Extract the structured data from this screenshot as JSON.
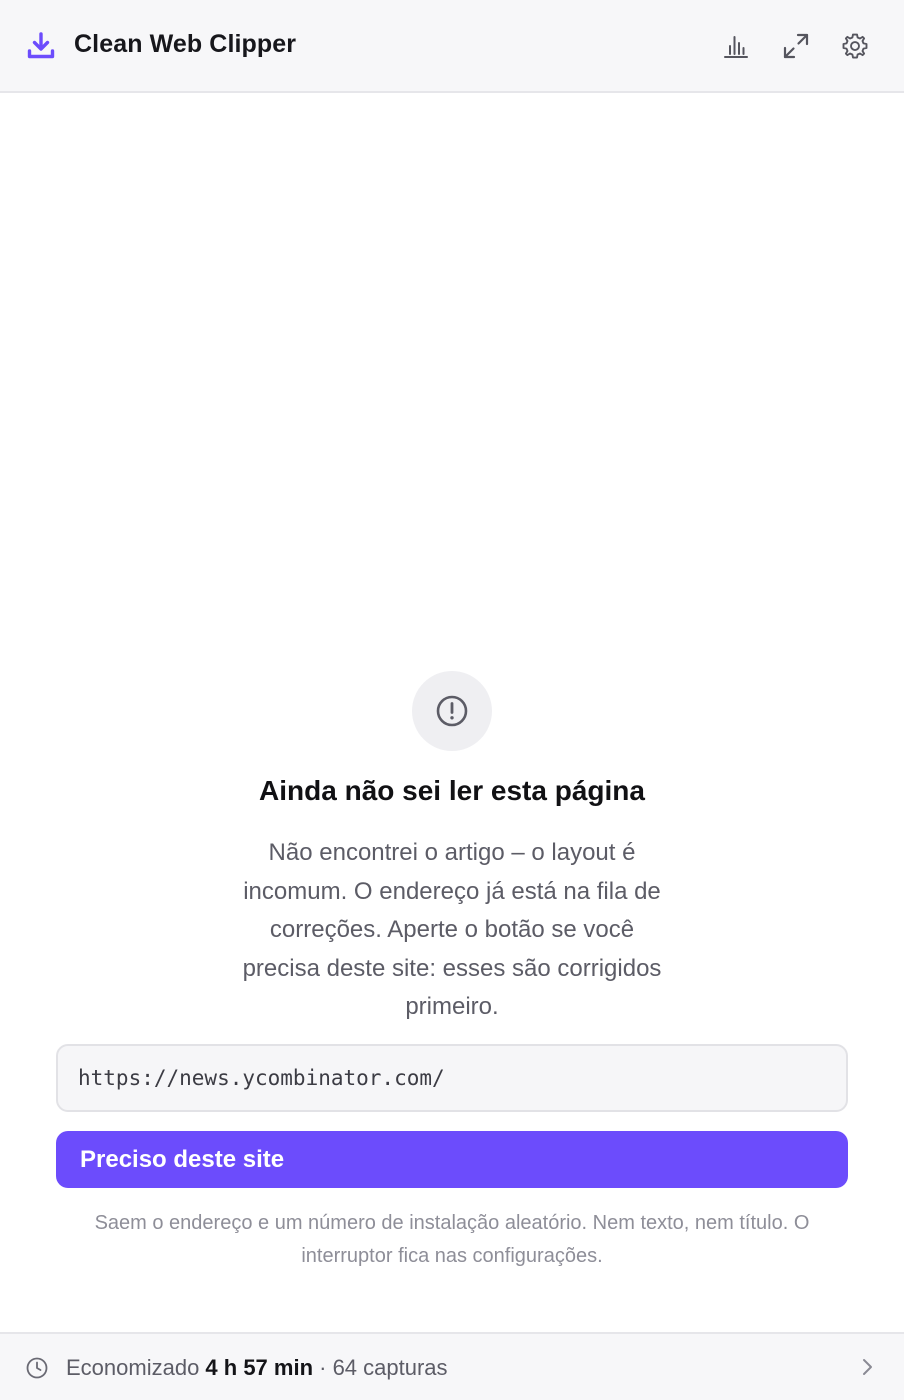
{
  "header": {
    "title": "Clean Web Clipper",
    "brand_icon": "download-icon",
    "actions": [
      {
        "name": "stats",
        "icon": "bar-chart-icon"
      },
      {
        "name": "expand",
        "icon": "expand-icon"
      },
      {
        "name": "settings",
        "icon": "gear-icon"
      }
    ]
  },
  "state": {
    "icon": "alert-circle-icon",
    "title": "Ainda não sei ler esta página",
    "description": "Não encontrei o artigo – o layout é incomum. O endereço já está na fila de correções. Aperte o botão se você precisa deste site: esses são corrigidos primeiro."
  },
  "url": "https://news.ycombinator.com/",
  "primary_button": "Preciso deste site",
  "privacy_note": "Saem o endereço e um número de instalação aleatório. Nem texto, nem título. O interruptor fica nas configurações.",
  "footer": {
    "prefix": "Economizado ",
    "time_saved": "4 h 57 min",
    "suffix": " · 64 capturas",
    "icon": "clock-icon",
    "chevron": "chevron-right-icon"
  },
  "colors": {
    "accent": "#6c4cfc",
    "header_bg": "#f7f7f9",
    "muted_text": "#5c5c66"
  }
}
